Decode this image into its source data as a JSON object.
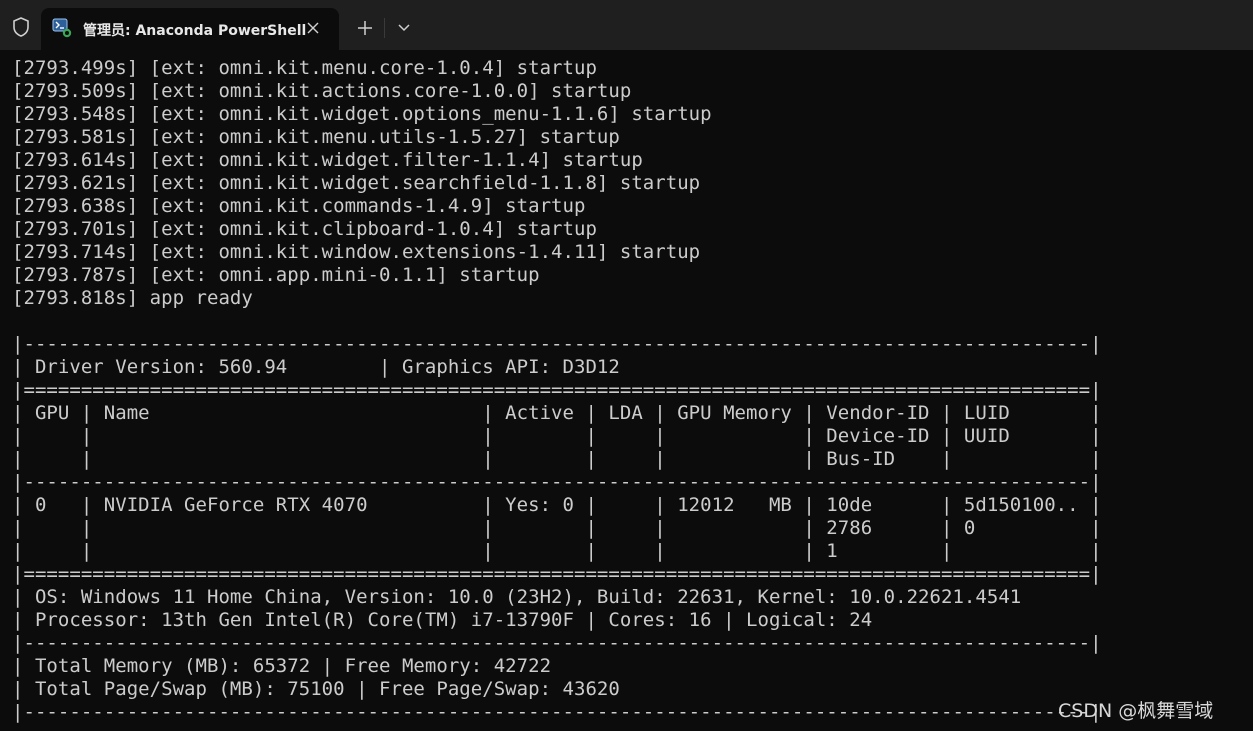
{
  "tab": {
    "title": "管理员: Anaconda PowerShell"
  },
  "icons": {
    "shield": "shield-icon",
    "terminal": "powershell-icon",
    "close": "close-icon",
    "plus": "plus-icon",
    "chevron": "chevron-down-icon"
  },
  "colors": {
    "background": "#0c0c0c",
    "titlebar": "#1f1f1f",
    "text": "#cccccc"
  },
  "terminal": {
    "lines": [
      "[2793.499s] [ext: omni.kit.menu.core-1.0.4] startup",
      "[2793.509s] [ext: omni.kit.actions.core-1.0.0] startup",
      "[2793.548s] [ext: omni.kit.widget.options_menu-1.1.6] startup",
      "[2793.581s] [ext: omni.kit.menu.utils-1.5.27] startup",
      "[2793.614s] [ext: omni.kit.widget.filter-1.1.4] startup",
      "[2793.621s] [ext: omni.kit.widget.searchfield-1.1.8] startup",
      "[2793.638s] [ext: omni.kit.commands-1.4.9] startup",
      "[2793.701s] [ext: omni.kit.clipboard-1.0.4] startup",
      "[2793.714s] [ext: omni.kit.window.extensions-1.4.11] startup",
      "[2793.787s] [ext: omni.app.mini-0.1.1] startup",
      "[2793.818s] app ready",
      "",
      "|---------------------------------------------------------------------------------------------|",
      "| Driver Version: 560.94        | Graphics API: D3D12",
      "|=============================================================================================|",
      "| GPU | Name                             | Active | LDA | GPU Memory | Vendor-ID | LUID       |",
      "|     |                                  |        |     |            | Device-ID | UUID       |",
      "|     |                                  |        |     |            | Bus-ID    |            |",
      "|---------------------------------------------------------------------------------------------|",
      "| 0   | NVIDIA GeForce RTX 4070          | Yes: 0 |     | 12012   MB | 10de      | 5d150100.. |",
      "|     |                                  |        |     |            | 2786      | 0          |",
      "|     |                                  |        |     |            | 1         |            |",
      "|=============================================================================================|",
      "| OS: Windows 11 Home China, Version: 10.0 (23H2), Build: 22631, Kernel: 10.0.22621.4541",
      "| Processor: 13th Gen Intel(R) Core(TM) i7-13790F | Cores: 16 | Logical: 24",
      "|---------------------------------------------------------------------------------------------|",
      "| Total Memory (MB): 65372 | Free Memory: 42722",
      "| Total Page/Swap (MB): 75100 | Free Page/Swap: 43620",
      "|---------------------------------------------------------------------------------------------|"
    ]
  },
  "watermark": "CSDN @枫舞雪域"
}
